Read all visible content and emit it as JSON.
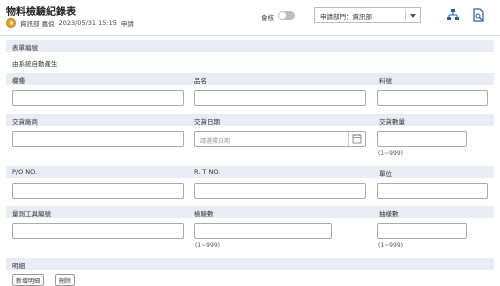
{
  "header": {
    "title": "物料檢驗紀錄表",
    "user": "資訊部 嘉俍",
    "datetime": "2023/05/31 15:15",
    "status": "申請",
    "toggle_label": "會核",
    "dept_select_value": "申請部門：資訊部"
  },
  "form": {
    "form_no_label": "表單編號",
    "form_no_value": "由系統自動產生",
    "row1": {
      "col1_label": "欄種",
      "col2_label": "品名",
      "col3_label": "料號"
    },
    "row2": {
      "col1_label": "交貨廠商",
      "col2_label": "交貨日期",
      "col2_placeholder": "請選擇日期",
      "col3_label": "交貨數量",
      "col3_hint": "(1~999)"
    },
    "row3": {
      "col1_label": "P/O NO.",
      "col2_label": "R. T NO.",
      "col3_label": "單位"
    },
    "row4": {
      "col1_label": "量測工具編號",
      "col2_label": "檢驗數",
      "col2_hint": "(1~999)",
      "col3_label": "抽樣數",
      "col3_hint": "(1~999)"
    },
    "detail_label": "明細",
    "detail_buttons": [
      "新增明細",
      "刪除"
    ]
  }
}
